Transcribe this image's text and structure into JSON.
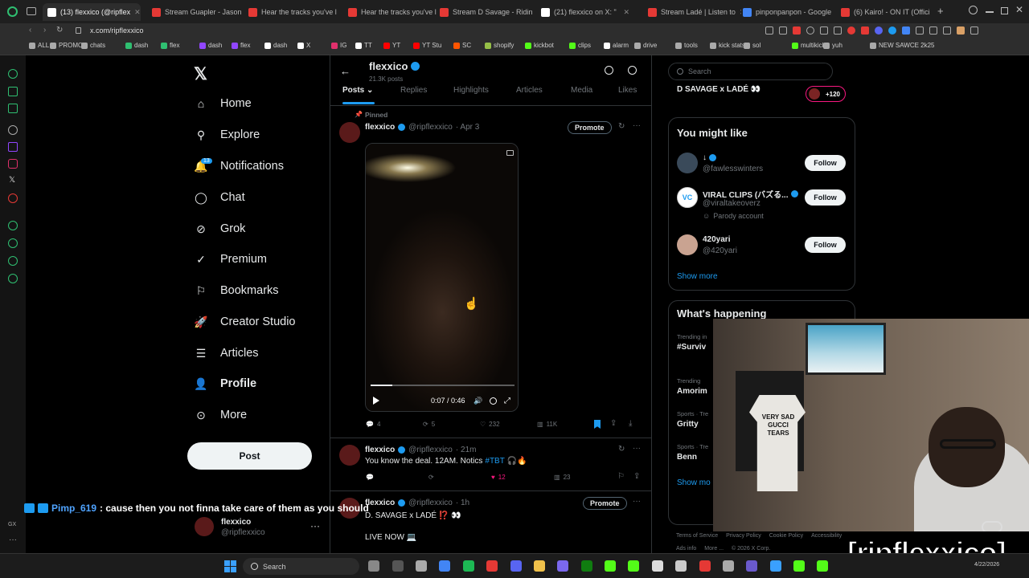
{
  "browser": {
    "tabs": [
      {
        "label": "(13) flexxico (@ripflex",
        "color": "#ffffff",
        "active": true
      },
      {
        "label": "Stream Guapler - Jason",
        "color": "#e53935"
      },
      {
        "label": "Hear the tracks you've l",
        "color": "#e53935"
      },
      {
        "label": "Hear the tracks you've l",
        "color": "#e53935"
      },
      {
        "label": "Stream D Savage - Ridin",
        "color": "#e53935"
      },
      {
        "label": "(21) flexxico on X: \"",
        "color": "#ffffff"
      },
      {
        "label": "Stream Ladé | Listen to",
        "color": "#e53935"
      },
      {
        "label": "pinponpanpon - Google",
        "color": "#4285f4"
      },
      {
        "label": "(6) Kairo! - ON IT (Offici",
        "color": "#e53935"
      }
    ],
    "new_tab": "+",
    "url": "x.com/ripflexxico",
    "bookmarks": [
      {
        "label": "ALL",
        "color": "#aaaaaa"
      },
      {
        "label": "PROMO",
        "color": "#aaaaaa"
      },
      {
        "label": "chats",
        "color": "#aaaaaa"
      },
      {
        "label": "dash",
        "color": "#2fbf71"
      },
      {
        "label": "flex",
        "color": "#2fbf71"
      },
      {
        "label": "dash",
        "color": "#9146ff"
      },
      {
        "label": "flex",
        "color": "#9146ff"
      },
      {
        "label": "dash",
        "color": "#ffffff"
      },
      {
        "label": "X",
        "color": "#ffffff"
      },
      {
        "label": "IG",
        "color": "#e1306c"
      },
      {
        "label": "TT",
        "color": "#ffffff"
      },
      {
        "label": "YT",
        "color": "#ff0000"
      },
      {
        "label": "YT Stu",
        "color": "#ff0000"
      },
      {
        "label": "SC",
        "color": "#ff5500"
      },
      {
        "label": "shopify",
        "color": "#95bf47"
      },
      {
        "label": "kickbot",
        "color": "#53fc18"
      },
      {
        "label": "clips",
        "color": "#53fc18"
      },
      {
        "label": "alarm",
        "color": "#ffffff"
      },
      {
        "label": "drive",
        "color": "#aaaaaa"
      },
      {
        "label": "tools",
        "color": "#aaaaaa"
      },
      {
        "label": "kick stats",
        "color": "#aaaaaa"
      },
      {
        "label": "sol",
        "color": "#aaaaaa"
      },
      {
        "label": "multikick",
        "color": "#53fc18"
      },
      {
        "label": "yuh",
        "color": "#aaaaaa"
      },
      {
        "label": "NEW SAWCE 2k25",
        "color": "#aaaaaa"
      }
    ]
  },
  "nav": {
    "items": [
      {
        "label": "Home",
        "icon": "home-icon"
      },
      {
        "label": "Explore",
        "icon": "search-icon"
      },
      {
        "label": "Notifications",
        "icon": "bell-icon",
        "badge": "13"
      },
      {
        "label": "Chat",
        "icon": "chat-icon"
      },
      {
        "label": "Grok",
        "icon": "grok-icon"
      },
      {
        "label": "Premium",
        "icon": "premium-icon"
      },
      {
        "label": "Bookmarks",
        "icon": "bookmark-icon"
      },
      {
        "label": "Creator Studio",
        "icon": "rocket-icon"
      },
      {
        "label": "Articles",
        "icon": "articles-icon"
      },
      {
        "label": "Profile",
        "icon": "profile-icon"
      },
      {
        "label": "More",
        "icon": "more-icon"
      }
    ],
    "post_button": "Post",
    "account_name": "flexxico",
    "account_handle": "@ripflexxico"
  },
  "profile": {
    "name": "flexxico",
    "posts_count": "21.3K posts",
    "tabs": [
      "Posts",
      "Replies",
      "Highlights",
      "Articles",
      "Media",
      "Likes"
    ]
  },
  "tweets": [
    {
      "pinned_label": "Pinned",
      "name": "flexxico",
      "handle": "@ripflexxico",
      "time": "· Apr 3",
      "promote": "Promote",
      "video_time": "0:07 / 0:46",
      "video_progress": 0.15,
      "replies": "4",
      "reposts": "5",
      "likes": "232",
      "views": "11K"
    },
    {
      "name": "flexxico",
      "handle": "@ripflexxico",
      "time": "· 21m",
      "text": "You know the deal. 12AM. Notics",
      "hashtag": "#TBT",
      "emoji": "🎧🔥",
      "likes": "12",
      "views": "23"
    },
    {
      "name": "flexxico",
      "handle": "@ripflexxico",
      "time": "· 1h",
      "promote": "Promote",
      "text": "D. SAVAGE x LADÉ ⁉️ 👀",
      "text2": "LIVE NOW 💻"
    }
  ],
  "sidebar": {
    "search_placeholder": "Search",
    "space_title": "D SAVAGE x LADÉ 👀",
    "space_count": "+120",
    "wtf_title": "You might like",
    "suggestions": [
      {
        "name": "↓",
        "handle": "@fawlesswinters",
        "follow": "Follow"
      },
      {
        "name": "VIRAL CLIPS (バズる...",
        "handle": "@viraltakeoverz",
        "note": "Parody account",
        "follow": "Follow"
      },
      {
        "name": "420yari",
        "handle": "@420yari",
        "follow": "Follow"
      }
    ],
    "show_more": "Show more",
    "happening_title": "What's happening",
    "trends": [
      {
        "context": "Trending in",
        "name": "#Surviv"
      },
      {
        "context": "Trending",
        "name": "Amorim"
      },
      {
        "context": "Sports · Tre",
        "name": "Gritty"
      },
      {
        "context": "Sports · Tre",
        "name": "Benn"
      }
    ],
    "show_more_2": "Show mo",
    "footer": [
      "Terms of Service",
      "Privacy Policy",
      "Cookie Policy",
      "Accessibility",
      "Ads info",
      "More ...",
      "© 2026 X Corp."
    ]
  },
  "overlay": {
    "chat_user": "Pimp_619",
    "chat_message": ": cause then you not finna take care of them as you should",
    "watermark": "[ripflexxico]",
    "shirt_text_1": "VERY SAD",
    "shirt_text_2": "GUCCI TEARS"
  },
  "taskbar": {
    "search_label": "Search",
    "clock_date": "4/22/2026"
  },
  "colors": {
    "accent": "#1d9bf0",
    "like": "#f91880",
    "green": "#2fbf71"
  }
}
